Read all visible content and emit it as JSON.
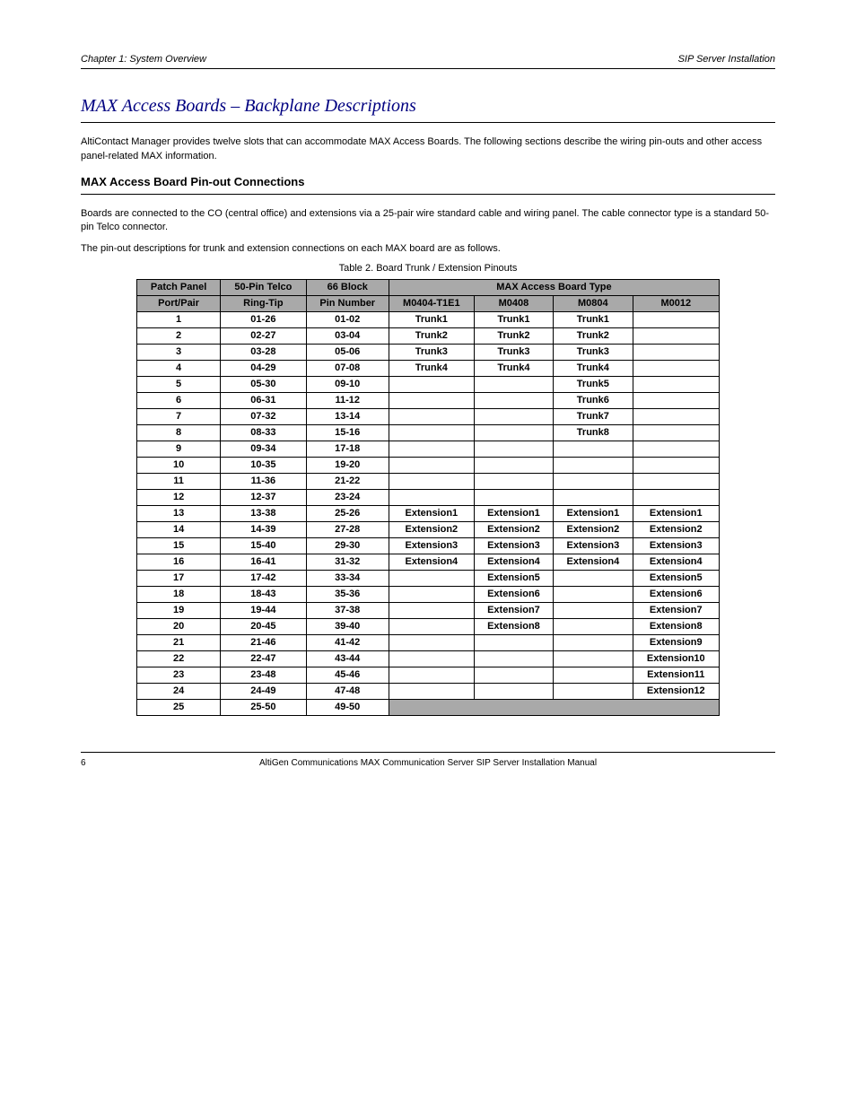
{
  "header": {
    "left": "Chapter 1: System Overview",
    "right": "SIP Server Installation"
  },
  "section_title": "MAX Access Boards – Backplane Descriptions",
  "body_paragraph": "AltiContact Manager provides twelve slots that can accommodate MAX Access Boards. The following sections describe the wiring pin-outs and other access panel-related MAX information.",
  "mab_title": "MAX Access Board Pin-out Connections",
  "mab_p1": "Boards are connected to the CO (central office) and extensions via a 25-pair wire standard cable and wiring panel. The cable connector type is a standard 50-pin Telco connector.",
  "mab_p2": "The pin-out descriptions for trunk and extension connections on each MAX board are as follows.",
  "table_caption": "Table 2. Board Trunk / Extension Pinouts",
  "headers": {
    "patch": "Patch Panel",
    "telco": "50-Pin Telco",
    "block": "66 Block",
    "board_type": "MAX Access Board Type",
    "port": "Port/Pair",
    "ring": "Ring-Tip",
    "pin": "Pin Number",
    "m0404": "M0404-T1E1",
    "m0408": "M0408",
    "m0804": "M0804",
    "m0012": "M0012"
  },
  "rows": [
    {
      "port": "1",
      "ring": "01-26",
      "pin": "01-02",
      "m0404": "Trunk1",
      "m0408": "Trunk1",
      "m0804": "Trunk1",
      "m0012": ""
    },
    {
      "port": "2",
      "ring": "02-27",
      "pin": "03-04",
      "m0404": "Trunk2",
      "m0408": "Trunk2",
      "m0804": "Trunk2",
      "m0012": ""
    },
    {
      "port": "3",
      "ring": "03-28",
      "pin": "05-06",
      "m0404": "Trunk3",
      "m0408": "Trunk3",
      "m0804": "Trunk3",
      "m0012": ""
    },
    {
      "port": "4",
      "ring": "04-29",
      "pin": "07-08",
      "m0404": "Trunk4",
      "m0408": "Trunk4",
      "m0804": "Trunk4",
      "m0012": ""
    },
    {
      "port": "5",
      "ring": "05-30",
      "pin": "09-10",
      "m0404": "",
      "m0408": "",
      "m0804": "Trunk5",
      "m0012": ""
    },
    {
      "port": "6",
      "ring": "06-31",
      "pin": "11-12",
      "m0404": "",
      "m0408": "",
      "m0804": "Trunk6",
      "m0012": ""
    },
    {
      "port": "7",
      "ring": "07-32",
      "pin": "13-14",
      "m0404": "",
      "m0408": "",
      "m0804": "Trunk7",
      "m0012": ""
    },
    {
      "port": "8",
      "ring": "08-33",
      "pin": "15-16",
      "m0404": "",
      "m0408": "",
      "m0804": "Trunk8",
      "m0012": ""
    },
    {
      "port": "9",
      "ring": "09-34",
      "pin": "17-18",
      "m0404": "",
      "m0408": "",
      "m0804": "",
      "m0012": ""
    },
    {
      "port": "10",
      "ring": "10-35",
      "pin": "19-20",
      "m0404": "",
      "m0408": "",
      "m0804": "",
      "m0012": ""
    },
    {
      "port": "11",
      "ring": "11-36",
      "pin": "21-22",
      "m0404": "",
      "m0408": "",
      "m0804": "",
      "m0012": ""
    },
    {
      "port": "12",
      "ring": "12-37",
      "pin": "23-24",
      "m0404": "",
      "m0408": "",
      "m0804": "",
      "m0012": ""
    },
    {
      "port": "13",
      "ring": "13-38",
      "pin": "25-26",
      "m0404": "Extension1",
      "m0408": "Extension1",
      "m0804": "Extension1",
      "m0012": "Extension1"
    },
    {
      "port": "14",
      "ring": "14-39",
      "pin": "27-28",
      "m0404": "Extension2",
      "m0408": "Extension2",
      "m0804": "Extension2",
      "m0012": "Extension2"
    },
    {
      "port": "15",
      "ring": "15-40",
      "pin": "29-30",
      "m0404": "Extension3",
      "m0408": "Extension3",
      "m0804": "Extension3",
      "m0012": "Extension3"
    },
    {
      "port": "16",
      "ring": "16-41",
      "pin": "31-32",
      "m0404": "Extension4",
      "m0408": "Extension4",
      "m0804": "Extension4",
      "m0012": "Extension4"
    },
    {
      "port": "17",
      "ring": "17-42",
      "pin": "33-34",
      "m0404": "",
      "m0408": "Extension5",
      "m0804": "",
      "m0012": "Extension5"
    },
    {
      "port": "18",
      "ring": "18-43",
      "pin": "35-36",
      "m0404": "",
      "m0408": "Extension6",
      "m0804": "",
      "m0012": "Extension6"
    },
    {
      "port": "19",
      "ring": "19-44",
      "pin": "37-38",
      "m0404": "",
      "m0408": "Extension7",
      "m0804": "",
      "m0012": "Extension7"
    },
    {
      "port": "20",
      "ring": "20-45",
      "pin": "39-40",
      "m0404": "",
      "m0408": "Extension8",
      "m0804": "",
      "m0012": "Extension8"
    },
    {
      "port": "21",
      "ring": "21-46",
      "pin": "41-42",
      "m0404": "",
      "m0408": "",
      "m0804": "",
      "m0012": "Extension9"
    },
    {
      "port": "22",
      "ring": "22-47",
      "pin": "43-44",
      "m0404": "",
      "m0408": "",
      "m0804": "",
      "m0012": "Extension10"
    },
    {
      "port": "23",
      "ring": "23-48",
      "pin": "45-46",
      "m0404": "",
      "m0408": "",
      "m0804": "",
      "m0012": "Extension11"
    },
    {
      "port": "24",
      "ring": "24-49",
      "pin": "47-48",
      "m0404": "",
      "m0408": "",
      "m0804": "",
      "m0012": "Extension12"
    },
    {
      "port": "25",
      "ring": "25-50",
      "pin": "49-50",
      "m0404": "shaded",
      "m0408": "shaded",
      "m0804": "shaded",
      "m0012": "shaded"
    }
  ],
  "footer": {
    "page": "6",
    "center": "AltiGen Communications MAX Communication Server SIP Server Installation Manual"
  }
}
